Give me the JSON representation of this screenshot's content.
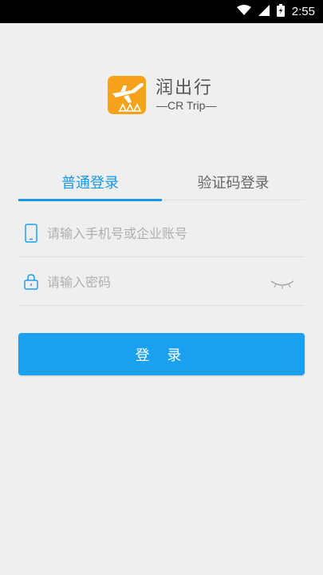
{
  "status_bar": {
    "time": "2:55"
  },
  "brand": {
    "name": "润出行",
    "subtitle": "—CR Trip—",
    "logo_color": "#f7a21b"
  },
  "tabs": [
    {
      "label": "普通登录",
      "active": true
    },
    {
      "label": "验证码登录",
      "active": false
    }
  ],
  "form": {
    "phone_placeholder": "请输入手机号或企业账号",
    "phone_value": "",
    "password_placeholder": "请输入密码",
    "password_value": ""
  },
  "login_button": {
    "label": "登 录"
  },
  "colors": {
    "accent": "#1a97e8",
    "button": "#1aa0ef",
    "background": "#efefef"
  }
}
